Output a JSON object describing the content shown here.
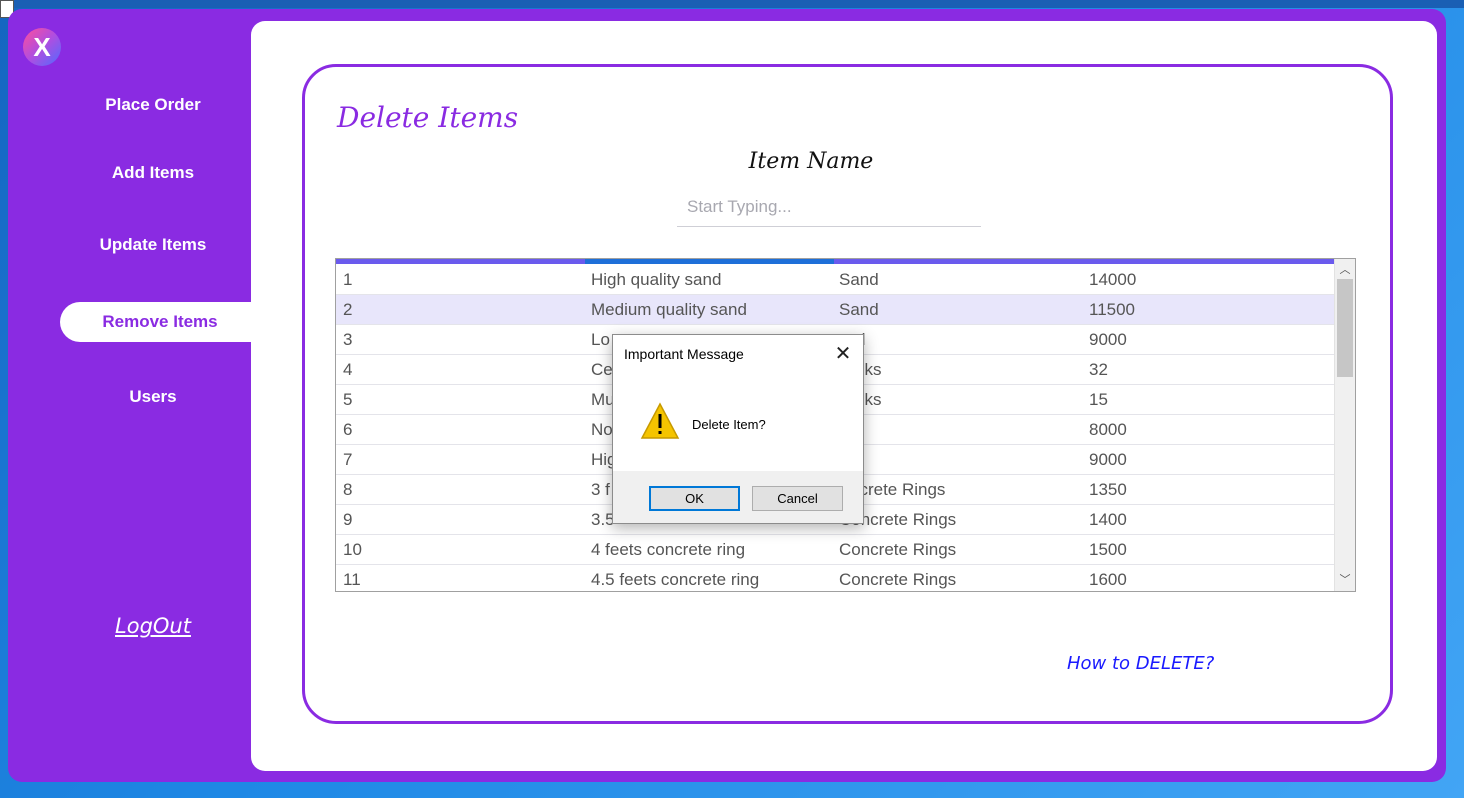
{
  "sidebar": {
    "logo_letter": "X",
    "items": [
      {
        "label": "Place Order"
      },
      {
        "label": "Add Items"
      },
      {
        "label": "Update Items"
      },
      {
        "label": "Remove Items"
      },
      {
        "label": "Users"
      }
    ],
    "active_index": 3,
    "logout_label": "LogOut"
  },
  "main": {
    "title": "Delete Items",
    "field_label": "Item Name",
    "search": {
      "placeholder": "Start Typing...",
      "value": ""
    },
    "rows": [
      {
        "id": "1",
        "name": "High quality sand",
        "category": "Sand",
        "price": "14000"
      },
      {
        "id": "2",
        "name": "Medium quality sand",
        "category": "Sand",
        "price": "11500"
      },
      {
        "id": "3",
        "name": "Lo",
        "category": "d",
        "price": "9000"
      },
      {
        "id": "4",
        "name": "Ce",
        "category": "cks",
        "price": "32"
      },
      {
        "id": "5",
        "name": "Mu",
        "category": "cks",
        "price": "15"
      },
      {
        "id": "6",
        "name": "No",
        "category": "",
        "price": "8000"
      },
      {
        "id": "7",
        "name": "Hig",
        "category": "",
        "price": "9000"
      },
      {
        "id": "8",
        "name": "3 f",
        "category": "ncrete Rings",
        "price": "1350"
      },
      {
        "id": "9",
        "name": "3.5",
        "category": "Concrete Rings",
        "price": "1400"
      },
      {
        "id": "10",
        "name": "4 feets concrete ring",
        "category": "Concrete Rings",
        "price": "1500"
      },
      {
        "id": "11",
        "name": "4.5 feets concrete ring",
        "category": "Concrete Rings",
        "price": "1600"
      }
    ],
    "selected_row": 1,
    "help_link": "How to DELETE?"
  },
  "dialog": {
    "title": "Important Message",
    "message": "Delete Item?",
    "ok_label": "OK",
    "cancel_label": "Cancel",
    "icon": "warning-icon",
    "close_glyph": "✕"
  },
  "colors": {
    "accent": "#8a2be2",
    "link": "#1a1aff",
    "grid_header": "#6a5aed",
    "selected_row": "#e8e6fb"
  }
}
